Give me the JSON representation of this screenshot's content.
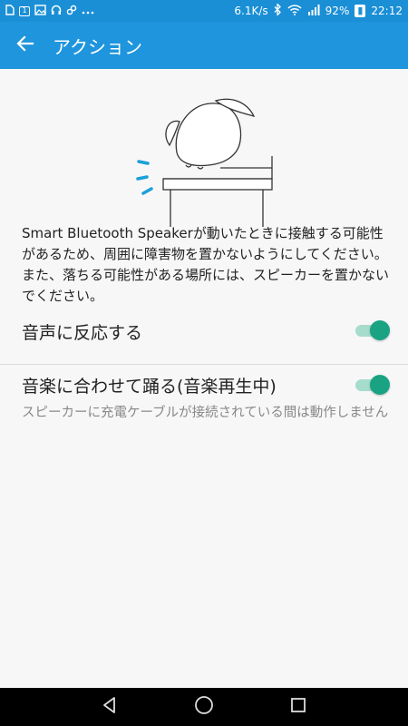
{
  "status_bar": {
    "left_icons": [
      "sim-icon",
      "calendar-icon",
      "image-icon",
      "headset-icon",
      "link-icon",
      "more-icon"
    ],
    "net_speed": "6.1K/s",
    "battery": "92%",
    "time": "22:12"
  },
  "app_bar": {
    "title": "アクション"
  },
  "description": "Smart Bluetooth Speakerが動いたときに接触する可能性があるため、周囲に障害物を置かないようにしてください。また、落ちる可能性がある場所には、スピーカーを置かないでください。",
  "settings": [
    {
      "title": "音声に反応する",
      "enabled": true
    },
    {
      "title": "音楽に合わせて踊る(音楽再生中)",
      "subtitle": "スピーカーに充電ケーブルが接続されている間は動作しません",
      "enabled": true
    }
  ],
  "colors": {
    "app_bar": "#1e95dd",
    "switch_on": "#19a383",
    "switch_track": "#a6dccc",
    "accent_marks": "#1aa0d8"
  }
}
